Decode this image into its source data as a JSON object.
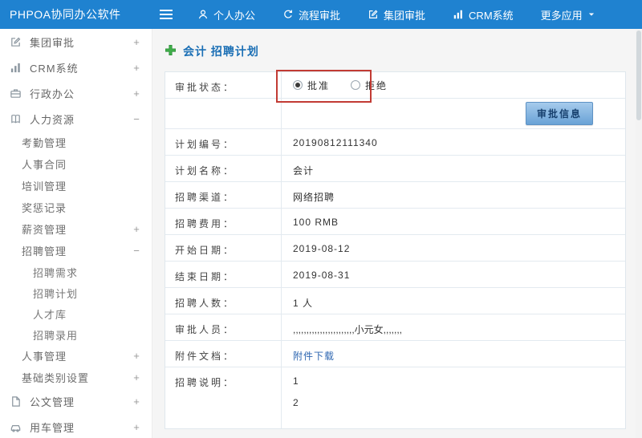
{
  "header": {
    "logo": "PHPOA协同办公软件",
    "nav": [
      {
        "label": "个人办公",
        "icon": "user-icon"
      },
      {
        "label": "流程审批",
        "icon": "flow-icon"
      },
      {
        "label": "集团审批",
        "icon": "edit-icon"
      },
      {
        "label": "CRM系统",
        "icon": "chart-icon"
      },
      {
        "label": "更多应用",
        "icon": "caret-down-icon"
      }
    ]
  },
  "sidebar": {
    "items": [
      {
        "label": "集团审批",
        "toggle": "+",
        "icon": "edit-square-icon",
        "level": 0
      },
      {
        "label": "CRM系统",
        "toggle": "+",
        "icon": "bar-chart-icon",
        "level": 0
      },
      {
        "label": "行政办公",
        "toggle": "+",
        "icon": "briefcase-icon",
        "level": 0
      },
      {
        "label": "人力资源",
        "toggle": "−",
        "icon": "book-icon",
        "level": 0
      },
      {
        "label": "考勤管理",
        "toggle": "",
        "level": 1
      },
      {
        "label": "人事合同",
        "toggle": "",
        "level": 1
      },
      {
        "label": "培训管理",
        "toggle": "",
        "level": 1
      },
      {
        "label": "奖惩记录",
        "toggle": "",
        "level": 1
      },
      {
        "label": "薪资管理",
        "toggle": "+",
        "level": 1
      },
      {
        "label": "招聘管理",
        "toggle": "−",
        "level": 1
      },
      {
        "label": "招聘需求",
        "toggle": "",
        "level": 2
      },
      {
        "label": "招聘计划",
        "toggle": "",
        "level": 2
      },
      {
        "label": "人才库",
        "toggle": "",
        "level": 2
      },
      {
        "label": "招聘录用",
        "toggle": "",
        "level": 2
      },
      {
        "label": "人事管理",
        "toggle": "+",
        "level": 1
      },
      {
        "label": "基础类别设置",
        "toggle": "+",
        "level": 1
      },
      {
        "label": "公文管理",
        "toggle": "+",
        "icon": "document-icon",
        "level": 0
      },
      {
        "label": "用车管理",
        "toggle": "+",
        "icon": "car-icon",
        "level": 0
      }
    ]
  },
  "main": {
    "page_title": "会计 招聘计划",
    "approval": {
      "label": "审批状态：",
      "options": [
        {
          "label": "批准",
          "selected": true
        },
        {
          "label": "拒绝",
          "selected": false
        }
      ],
      "info_button": "审批信息"
    },
    "fields": [
      {
        "label": "计划编号：",
        "value": "20190812111340"
      },
      {
        "label": "计划名称：",
        "value": "会计"
      },
      {
        "label": "招聘渠道：",
        "value": "网络招聘"
      },
      {
        "label": "招聘费用：",
        "value": "100 RMB"
      },
      {
        "label": "开始日期：",
        "value": "2019-08-12"
      },
      {
        "label": "结束日期：",
        "value": "2019-08-31"
      },
      {
        "label": "招聘人数：",
        "value": "1 人"
      },
      {
        "label": "审批人员：",
        "value": ",,,,,,,,,,,,,,,,,,,,,,,小元女,,,,,,,"
      },
      {
        "label": "附件文档：",
        "value": "附件下载"
      },
      {
        "label": "招聘说明：",
        "lines": [
          "1",
          "2"
        ]
      }
    ]
  },
  "colors": {
    "header_bg": "#1f82d0",
    "title_blue": "#1b6fb5",
    "annotation_red": "#c23b34",
    "link_blue": "#2d66b1"
  }
}
